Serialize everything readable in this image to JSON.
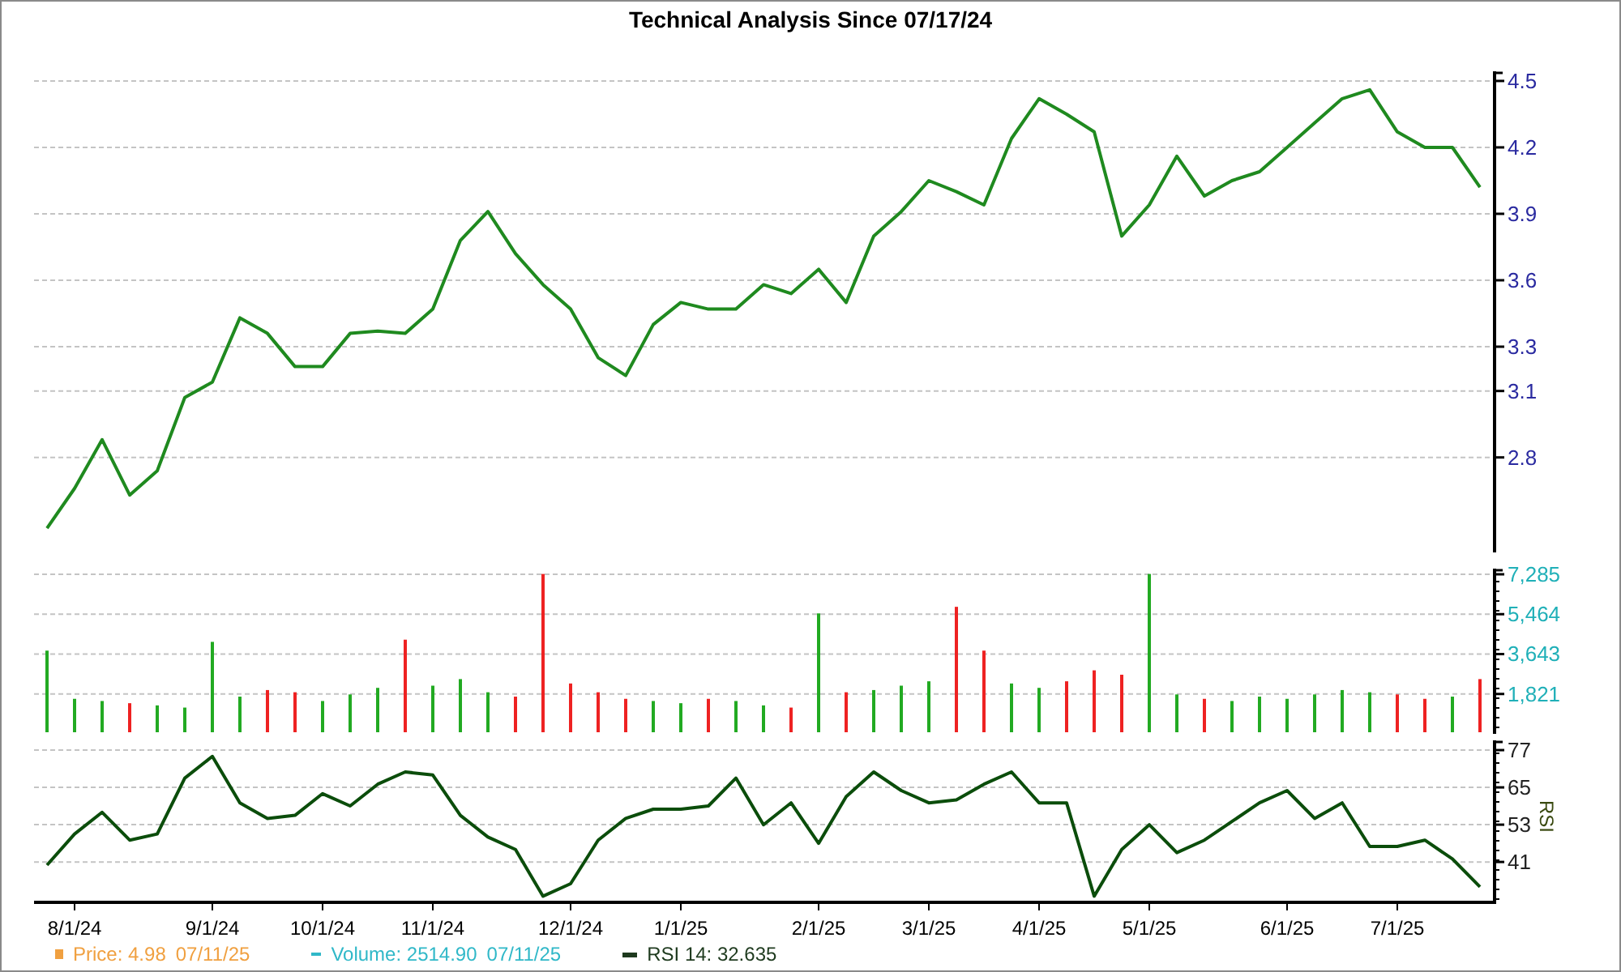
{
  "title": "Technical Analysis Since 07/17/24",
  "price_chart": {
    "chart_data": {
      "type": "line",
      "grid": true,
      "ylim": [
        2.371,
        4.529
      ],
      "yticks": [
        4.5,
        4.2,
        3.9,
        3.6,
        3.3,
        3.1,
        2.8
      ],
      "series": [
        {
          "color": "#1f8a1f",
          "values": [
            2.48,
            2.66,
            2.88,
            2.63,
            2.74,
            3.07,
            3.14,
            3.43,
            3.36,
            3.21,
            3.21,
            3.36,
            3.37,
            3.36,
            3.47,
            3.78,
            3.91,
            3.72,
            3.58,
            3.47,
            3.25,
            3.17,
            3.4,
            3.5,
            3.47,
            3.47,
            3.58,
            3.54,
            3.65,
            3.5,
            3.8,
            3.91,
            4.05,
            4.0,
            3.94,
            4.24,
            4.42,
            4.35,
            4.27,
            3.8,
            3.94,
            4.16,
            3.98,
            4.05,
            4.09,
            4.2,
            4.31,
            4.42,
            4.46,
            4.27,
            4.2,
            4.2,
            4.02
          ]
        }
      ]
    }
  },
  "volume_chart": {
    "chart_data": {
      "type": "bar",
      "grid": true,
      "ylim": [
        0,
        7396
      ],
      "yticks": [
        {
          "value": 7285,
          "label": "7,285"
        },
        {
          "value": 5464,
          "label": "5,464"
        },
        {
          "value": 3643,
          "label": "3,643"
        },
        {
          "value": 1821,
          "label": "1,821"
        }
      ],
      "series": [
        {
          "color": "#22aa22",
          "values": [
            3800,
            1600,
            1500,
            null,
            1300,
            1200,
            4200,
            1700,
            null,
            null,
            1500,
            1800,
            2100,
            null,
            2200,
            2500,
            1900,
            null,
            null,
            null,
            null,
            null,
            1500,
            1400,
            null,
            1500,
            1300,
            null,
            5500,
            null,
            2000,
            2200,
            2400,
            null,
            null,
            2300,
            2100,
            null,
            null,
            null,
            7300,
            1800,
            null,
            1500,
            1700,
            1600,
            1800,
            2000,
            1900,
            null,
            null,
            1700,
            null
          ]
        },
        {
          "color": "#ee2222",
          "values": [
            null,
            null,
            null,
            1400,
            null,
            null,
            null,
            null,
            2000,
            1900,
            null,
            null,
            null,
            4300,
            null,
            null,
            null,
            1700,
            7300,
            2300,
            1900,
            1600,
            null,
            null,
            1600,
            null,
            null,
            1200,
            null,
            1900,
            null,
            null,
            null,
            5800,
            3800,
            null,
            null,
            2400,
            2900,
            2700,
            null,
            null,
            1600,
            null,
            null,
            null,
            null,
            null,
            null,
            1800,
            1600,
            null,
            2500
          ]
        }
      ]
    }
  },
  "rsi_chart": {
    "chart_data": {
      "type": "line",
      "grid": true,
      "ylabel": "RSI",
      "ylim": [
        28,
        79.1
      ],
      "yticks": [
        77,
        65,
        53,
        41
      ],
      "categories": [
        null,
        "8/1/24",
        null,
        null,
        null,
        null,
        "9/1/24",
        null,
        null,
        null,
        "10/1/24",
        null,
        null,
        null,
        "11/1/24",
        null,
        null,
        null,
        null,
        "12/1/24",
        null,
        null,
        null,
        "1/1/25",
        null,
        null,
        null,
        null,
        "2/1/25",
        null,
        null,
        null,
        "3/1/25",
        null,
        null,
        null,
        "4/1/25",
        null,
        null,
        null,
        "5/1/25",
        null,
        null,
        null,
        null,
        "6/1/25",
        null,
        null,
        null,
        "7/1/25",
        null,
        null,
        null
      ],
      "series": [
        {
          "color": "#0b4d0b",
          "values": [
            40,
            50,
            57,
            48,
            50,
            68,
            75,
            60,
            55,
            56,
            63,
            59,
            66,
            70,
            69,
            56,
            49,
            45,
            30,
            34,
            48,
            55,
            58,
            58,
            59,
            68,
            53,
            60,
            47,
            62,
            70,
            64,
            60,
            61,
            66,
            70,
            60,
            60,
            30,
            45,
            53,
            44,
            48,
            54,
            60,
            64,
            55,
            60,
            46,
            46,
            48,
            42,
            33
          ]
        }
      ]
    }
  },
  "legend": [
    {
      "kind": "square",
      "label": "Price: 4.98",
      "date": "07/11/25",
      "color": "#f0a040"
    },
    {
      "kind": "dash",
      "label": "Volume: 2514.90",
      "date": "07/11/25",
      "color": "#30b8c8"
    },
    {
      "kind": "line",
      "label": "RSI 14: 32.635",
      "color": "#1e3a1e"
    }
  ]
}
